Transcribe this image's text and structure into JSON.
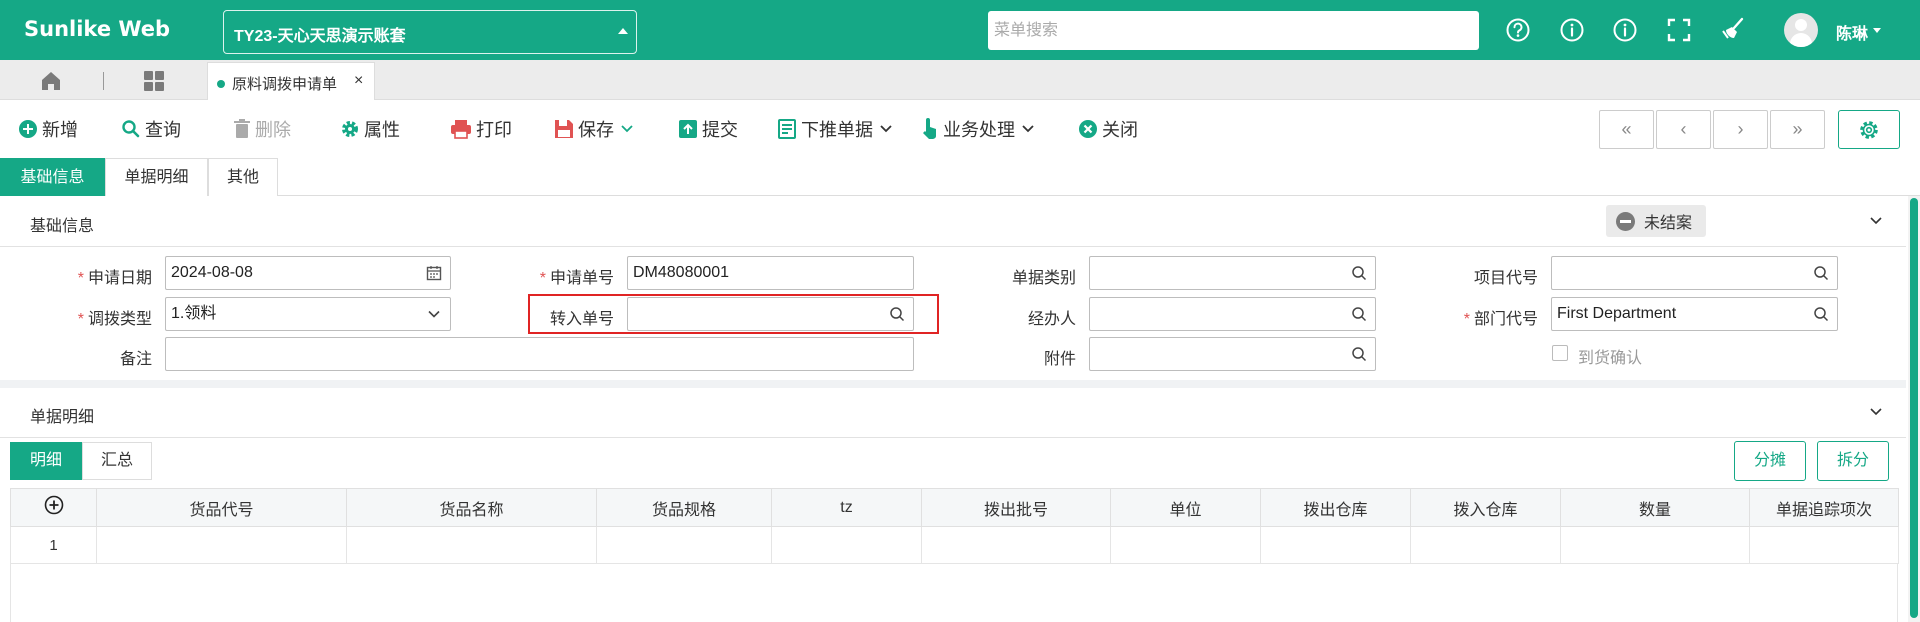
{
  "header": {
    "brand": "Sunlike Web",
    "account": "TY23-天心天思演示账套",
    "search_placeholder": "菜单搜索",
    "username": "陈琳",
    "icons": [
      "help-icon",
      "info-icon",
      "info-icon",
      "fullscreen-icon",
      "broom-icon",
      "avatar"
    ]
  },
  "tabbar": {
    "active_tab": "原料调拨申请单",
    "close": "×"
  },
  "toolbar": {
    "add": "新增",
    "query": "查询",
    "delete": "删除",
    "properties": "属性",
    "print": "打印",
    "save": "保存",
    "submit": "提交",
    "push_down": "下推单据",
    "business": "业务处理",
    "close": "关闭",
    "pager": [
      "«",
      "‹",
      "›",
      "»"
    ]
  },
  "section_tabs": [
    "基础信息",
    "单据明细",
    "其他"
  ],
  "basic_info": {
    "title": "基础信息",
    "status": "未结案",
    "fields": {
      "apply_date": {
        "label": "申请日期",
        "value": "2024-08-08"
      },
      "apply_no": {
        "label": "申请单号",
        "value": "DM48080001"
      },
      "doc_category": {
        "label": "单据类别",
        "value": ""
      },
      "project_code": {
        "label": "项目代号",
        "value": ""
      },
      "transfer_type": {
        "label": "调拨类型",
        "value": "1.领料"
      },
      "transfer_in_no": {
        "label": "转入单号",
        "value": ""
      },
      "handler": {
        "label": "经办人",
        "value": ""
      },
      "dept_code": {
        "label": "部门代号",
        "value": "First Department"
      },
      "remark": {
        "label": "备注",
        "value": ""
      },
      "attachment": {
        "label": "附件",
        "value": ""
      },
      "arrival_confirm": {
        "label": "到货确认",
        "checked": false
      }
    }
  },
  "detail": {
    "title": "单据明细",
    "sub_tabs": [
      "明细",
      "汇总"
    ],
    "buttons": {
      "allocate": "分摊",
      "split": "拆分"
    },
    "add_symbol": "+",
    "columns": [
      "货品代号",
      "货品名称",
      "货品规格",
      "tz",
      "拨出批号",
      "单位",
      "拨出仓库",
      "拨入仓库",
      "数量",
      "单据追踪项次"
    ],
    "rows": [
      {
        "no": "1",
        "cells": [
          "",
          "",
          "",
          "",
          "",
          "",
          "",
          "",
          "",
          ""
        ]
      }
    ]
  },
  "colors": {
    "primary": "#15a886",
    "required": "#e05353",
    "highlight": "#e02424"
  }
}
